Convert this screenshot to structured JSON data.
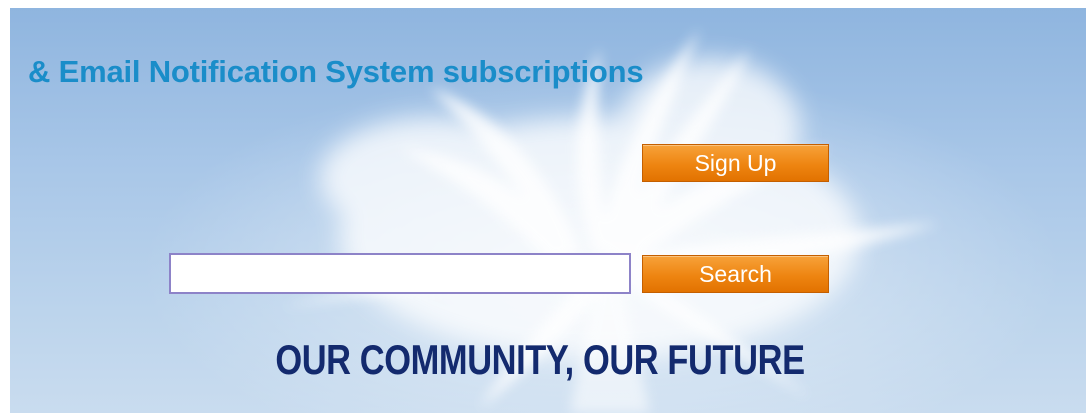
{
  "header": {
    "title": "& Email Notification System subscriptions"
  },
  "signup": {
    "button_label": "Sign Up"
  },
  "search": {
    "value": "",
    "placeholder": "",
    "button_label": "Search"
  },
  "tagline": {
    "text": "OUR COMMUNITY, OUR FUTURE"
  },
  "colors": {
    "heading": "#1a8dc9",
    "button_orange": "#ee8511",
    "tagline_navy": "#132a6e",
    "sky_blue": "#a9c7e8",
    "input_border": "#8d83c8"
  },
  "background": {
    "image_subject": "palm-tree-icon"
  }
}
